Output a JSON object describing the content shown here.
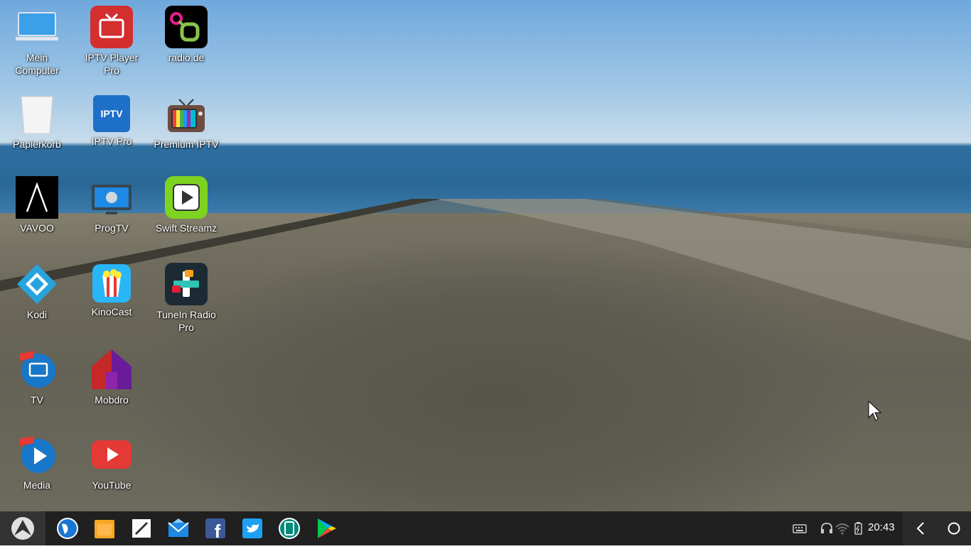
{
  "desktop": {
    "icons": [
      {
        "label": "Mein\nComputer",
        "icon": "computer-icon"
      },
      {
        "label": "Papierkorb",
        "icon": "trash-icon"
      },
      {
        "label": "VAVOO",
        "icon": "vavoo-icon"
      },
      {
        "label": "Kodi",
        "icon": "kodi-icon"
      },
      {
        "label": "TV",
        "icon": "tv-icon"
      },
      {
        "label": "Media",
        "icon": "media-icon"
      },
      {
        "label": "IPTV Player\nPro",
        "icon": "iptv-player-icon"
      },
      {
        "label": "IPTV Pro",
        "icon": "iptv-pro-icon"
      },
      {
        "label": "ProgTV",
        "icon": "progtv-icon"
      },
      {
        "label": "KinoCast",
        "icon": "kinocast-icon"
      },
      {
        "label": "Mobdro",
        "icon": "mobdro-icon"
      },
      {
        "label": "YouTube",
        "icon": "youtube-icon"
      },
      {
        "label": "radio.de",
        "icon": "radio-de-icon"
      },
      {
        "label": "Premium IPTV",
        "icon": "premium-iptv-icon"
      },
      {
        "label": "Swift Streamz",
        "icon": "swift-streamz-icon"
      },
      {
        "label": "TuneIn Radio\nPro",
        "icon": "tunein-icon"
      }
    ]
  },
  "taskbar": {
    "apps": [
      "browser-icon",
      "file-manager-icon",
      "notes-icon",
      "email-icon",
      "facebook-icon",
      "twitter-icon",
      "tablet-mode-icon",
      "play-store-icon"
    ],
    "tray": [
      "keyboard-icon",
      "headphones-icon",
      "wifi-icon",
      "battery-icon"
    ],
    "clock": "20:43"
  },
  "colors": {
    "taskbar_bg": "#202020",
    "accent": "#1e88e5"
  }
}
